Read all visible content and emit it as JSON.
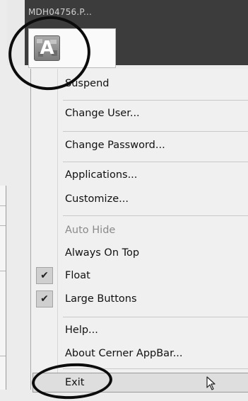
{
  "window": {
    "title": "MDH04756.P..."
  },
  "appbar": {
    "icon": "app-letter-a-icon",
    "icon_letter": "A"
  },
  "menu": {
    "items": [
      {
        "label": "Suspend",
        "enabled": true,
        "checked": false
      },
      {
        "label": "Change User...",
        "enabled": true,
        "checked": false
      },
      {
        "label": "Change Password...",
        "enabled": true,
        "checked": false
      },
      {
        "label": "Applications...",
        "enabled": true,
        "checked": false
      },
      {
        "label": "Customize...",
        "enabled": true,
        "checked": false
      },
      {
        "label": "Auto Hide",
        "enabled": false,
        "checked": false
      },
      {
        "label": "Always On Top",
        "enabled": true,
        "checked": false
      },
      {
        "label": "Float",
        "enabled": true,
        "checked": true
      },
      {
        "label": "Large Buttons",
        "enabled": true,
        "checked": true
      },
      {
        "label": "Help...",
        "enabled": true,
        "checked": false
      },
      {
        "label": "About Cerner AppBar...",
        "enabled": true,
        "checked": false
      },
      {
        "label": "Exit",
        "enabled": true,
        "checked": false,
        "highlighted": true
      }
    ],
    "check_glyph": "✔"
  },
  "annotations": {
    "circles": [
      "appbar-icon-highlight",
      "exit-item-highlight"
    ]
  },
  "colors": {
    "menu_bg": "#f0f0f0",
    "dark_bg": "#3c3c3c",
    "disabled_text": "#8a8a8a",
    "ring": "#0c0c0c"
  }
}
